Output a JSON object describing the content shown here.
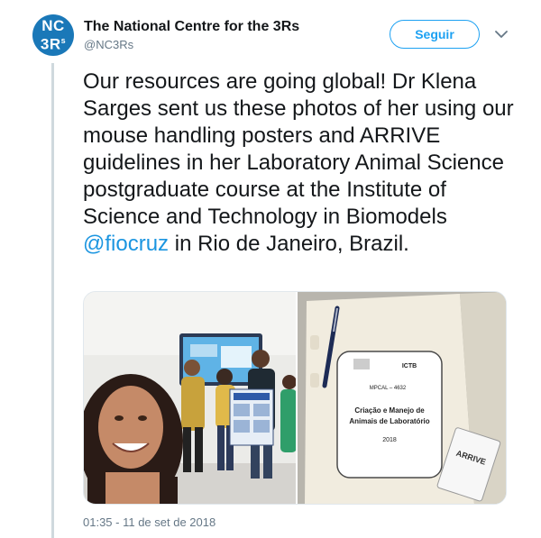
{
  "author": {
    "avatar_line1": "NC",
    "avatar_line2": "3R",
    "avatar_sup": "s",
    "name": "The National Centre for the 3Rs",
    "handle": "@NC3Rs"
  },
  "actions": {
    "follow_label": "Seguir",
    "menu_icon": "chevron-down-icon"
  },
  "tweet": {
    "text_before": "Our resources are going global! Dr Klena Sarges sent us these photos of her using our mouse handling posters and ARRIVE guidelines in her Laboratory Animal Science postgraduate course at the Institute of Science and Technology in Biomodels ",
    "mention": "@fiocruz",
    "text_after": " in Rio de Janeiro, Brazil.",
    "timestamp": "01:35 - 11 de set de 2018"
  },
  "photo_right": {
    "course_code": "MPCAL – 4632",
    "course_title_1": "Criação e Manejo de",
    "course_title_2": "Animais de Laboratório",
    "year": "2018",
    "brand": "ICTB",
    "arrive": "ARRIVE"
  },
  "colors": {
    "accent": "#1da1f2",
    "mention": "#1b95e0",
    "avatar": "#1a78b8"
  }
}
